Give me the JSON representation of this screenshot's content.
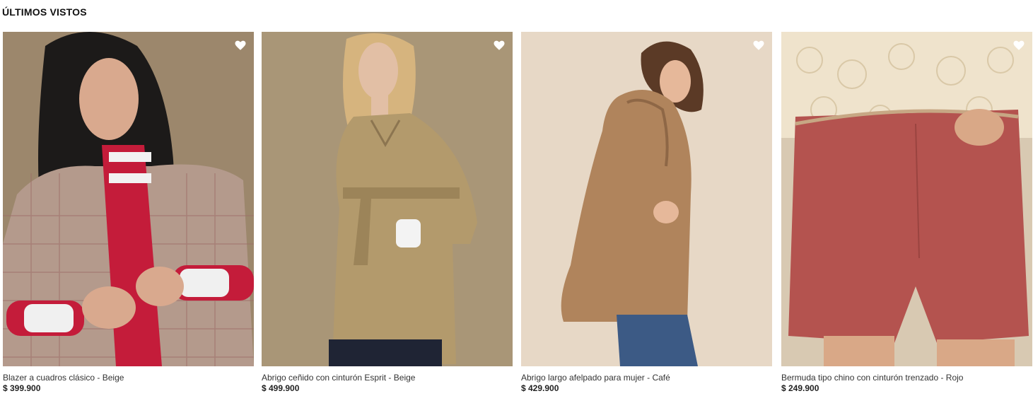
{
  "section": {
    "title": "ÚLTIMOS VISTOS"
  },
  "products": [
    {
      "name": "Blazer a cuadros clásico - Beige",
      "price": "$ 399.900",
      "icon": "heart-icon"
    },
    {
      "name": "Abrigo ceñido con cinturón Esprit - Beige",
      "price": "$ 499.900",
      "icon": "heart-icon"
    },
    {
      "name": "Abrigo largo afelpado para mujer  - Café",
      "price": "$ 429.900",
      "icon": "heart-icon"
    },
    {
      "name": "Bermuda tipo chino con cinturón trenzado - Rojo",
      "price": "$ 249.900",
      "icon": "heart-icon"
    }
  ]
}
